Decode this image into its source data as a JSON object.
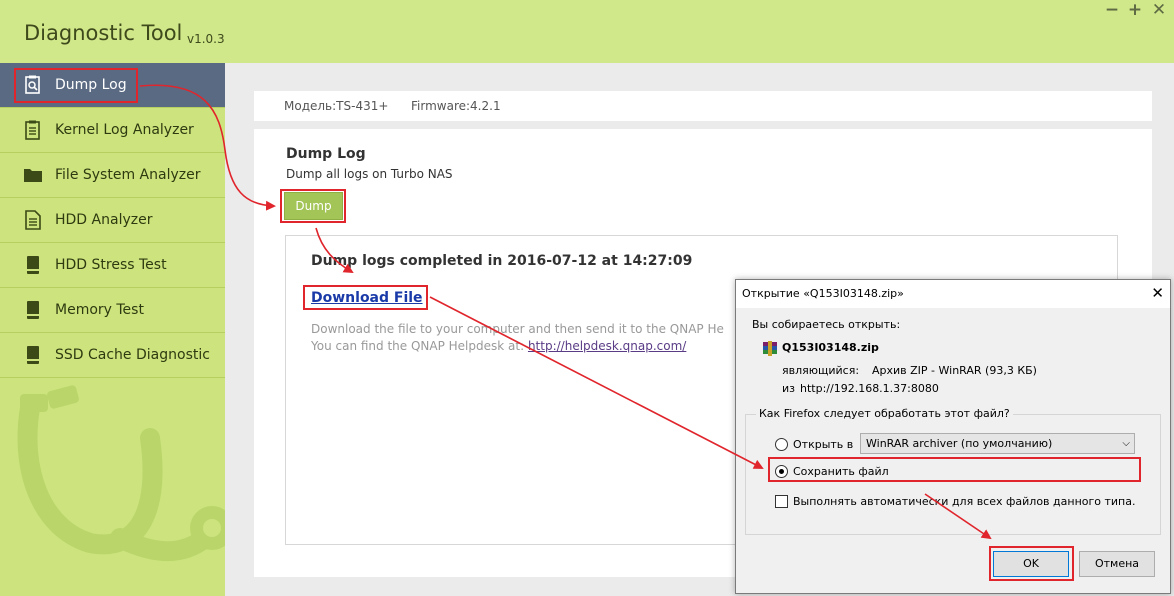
{
  "app": {
    "title": "Diagnostic Tool",
    "version": "v1.0.3",
    "controls": {
      "minimize": "−",
      "maximize": "+",
      "close": "✕"
    }
  },
  "sidebar": {
    "items": [
      {
        "label": "Dump Log",
        "icon": "dump-log-icon",
        "active": true
      },
      {
        "label": "Kernel Log Analyzer",
        "icon": "clipboard-icon",
        "active": false
      },
      {
        "label": "File System Analyzer",
        "icon": "folder-icon",
        "active": false
      },
      {
        "label": "HDD Analyzer",
        "icon": "document-icon",
        "active": false
      },
      {
        "label": "HDD Stress Test",
        "icon": "hdd-icon",
        "active": false
      },
      {
        "label": "Memory Test",
        "icon": "hdd-icon",
        "active": false
      },
      {
        "label": "SSD Cache Diagnostic",
        "icon": "hdd-icon",
        "active": false
      }
    ]
  },
  "device": {
    "model": "Модель:TS-431+",
    "firmware": "Firmware:4.2.1"
  },
  "panel": {
    "title": "Dump Log",
    "subtitle": "Dump all logs on Turbo NAS",
    "dump_button": "Dump",
    "result_title": "Dump logs completed in 2016-07-12 at 14:27:09",
    "download_link": "Download File",
    "desc_line1": "Download the file to your computer and then send it to the QNAP He",
    "desc_line2_prefix": "You can find the QNAP Helpdesk at: ",
    "helpdesk_url": "http://helpdesk.qnap.com/"
  },
  "dialog": {
    "title": "Открытие «Q153I03148.zip»",
    "intro": "Вы собираетесь открыть:",
    "file_name": "Q153I03148.zip",
    "type_label": "являющийся:",
    "type_value": "Архив ZIP - WinRAR (93,3 КБ)",
    "from_label": "из",
    "from_value": "http://192.168.1.37:8080",
    "question": "Как Firefox следует обработать этот файл?",
    "open_with_label": "Открыть в",
    "open_with_value": "WinRAR archiver (по умолчанию)",
    "save_label": "Сохранить файл",
    "auto_label": "Выполнять автоматически для всех файлов данного типа.",
    "ok": "OK",
    "cancel": "Отмена",
    "selected_option": "save"
  },
  "colors": {
    "sidebar_bg": "#cde47e",
    "titlebar_bg": "#d1e88a",
    "active_item_bg": "#5a6a82",
    "button_green": "#a3c456",
    "annotation_red": "#e0252c"
  }
}
